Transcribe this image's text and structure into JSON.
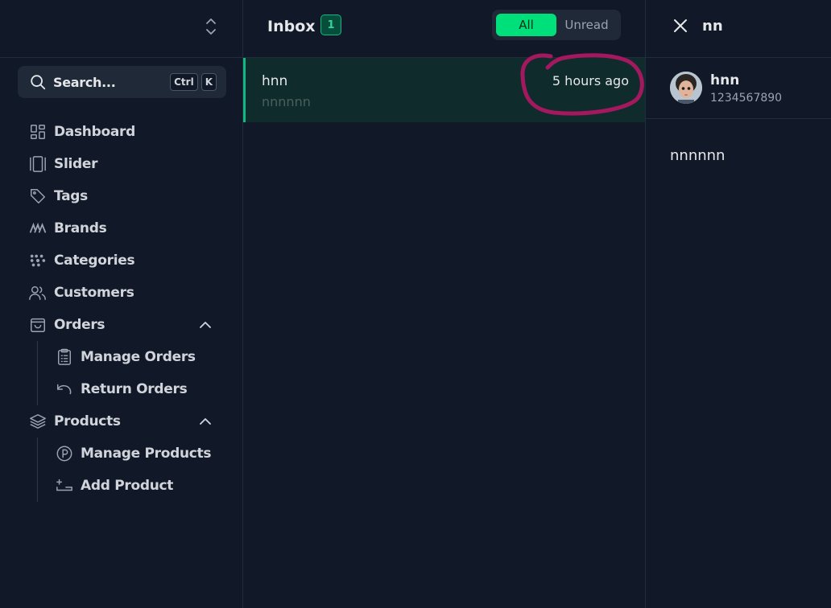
{
  "sidebar": {
    "search": {
      "label": "Search...",
      "shortcut_keys": [
        "Ctrl",
        "K"
      ]
    },
    "items": [
      {
        "label": "Dashboard",
        "icon": "dashboard-icon"
      },
      {
        "label": "Slider",
        "icon": "slider-icon"
      },
      {
        "label": "Tags",
        "icon": "tag-icon"
      },
      {
        "label": "Brands",
        "icon": "brands-icon"
      },
      {
        "label": "Categories",
        "icon": "categories-icon"
      },
      {
        "label": "Customers",
        "icon": "customers-icon"
      },
      {
        "label": "Orders",
        "icon": "shopping-bag-icon",
        "expanded": true,
        "children": [
          {
            "label": "Manage Orders",
            "icon": "clipboard-list-icon"
          },
          {
            "label": "Return Orders",
            "icon": "return-arrow-icon"
          }
        ]
      },
      {
        "label": "Products",
        "icon": "layers-icon",
        "expanded": true,
        "children": [
          {
            "label": "Manage Products",
            "icon": "product-badge-icon"
          },
          {
            "label": "Add Product",
            "icon": "add-product-icon"
          }
        ]
      }
    ]
  },
  "inbox": {
    "title": "Inbox",
    "count": "1",
    "filters": {
      "all": "All",
      "unread": "Unread",
      "active": "All"
    },
    "messages": [
      {
        "sender": "hnn",
        "preview": "nnnnnn",
        "time": "5 hours ago",
        "selected": true
      }
    ]
  },
  "detail": {
    "title": "nn",
    "contact": {
      "name": "hnn",
      "phone": "1234567890"
    },
    "body": "nnnnnn"
  },
  "colors": {
    "background": "#111827",
    "accent": "#00e07a",
    "selected_row": "#0f2b2b",
    "annotation": "#a3185e"
  }
}
